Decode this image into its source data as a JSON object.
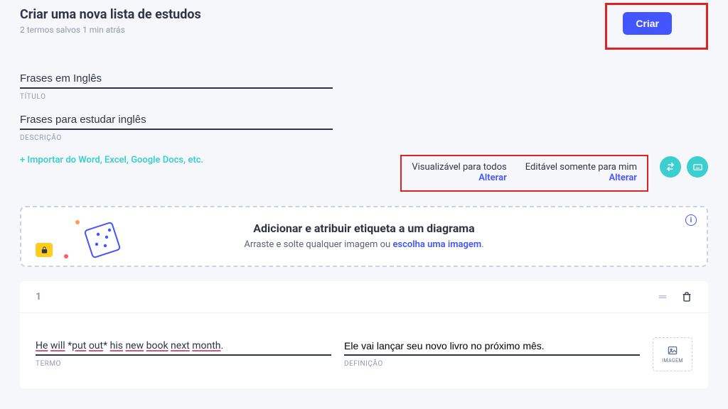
{
  "header": {
    "title": "Criar uma nova lista de estudos",
    "subtitle": "2 termos salvos 1 min atrás",
    "create_button": "Criar"
  },
  "form": {
    "title_value": "Frases em Inglês",
    "title_label": "TÍTULO",
    "desc_value": "Frases para estudar inglês",
    "desc_label": "DESCRIÇÃO",
    "import_link": "+ Importar do Word, Excel, Google Docs, etc."
  },
  "permissions": {
    "visible": {
      "title": "Visualizável para todos",
      "link": "Alterar"
    },
    "editable": {
      "title": "Editável somente para mim",
      "link": "Alterar"
    }
  },
  "diagram": {
    "title": "Adicionar e atribuir etiqueta a um diagrama",
    "subtitle_pre": "Arraste e solte qualquer imagem ou ",
    "subtitle_link": "escolha uma imagem",
    "subtitle_post": "."
  },
  "term_card": {
    "index": "1",
    "term_value_parts": [
      "He",
      " ",
      "will",
      " *",
      "put",
      " ",
      "out",
      "* ",
      "his",
      " ",
      "new",
      " ",
      "book",
      " ",
      "next",
      " ",
      "month",
      "."
    ],
    "term_underlined": [
      "He",
      "will",
      "put",
      "out",
      "his",
      "new",
      "book",
      "next",
      "month"
    ],
    "term_label": "TERMO",
    "definition_value": "Ele vai lançar seu novo livro no próximo mês.",
    "definition_label": "DEFINIÇÃO",
    "image_label": "IMAGEM"
  }
}
